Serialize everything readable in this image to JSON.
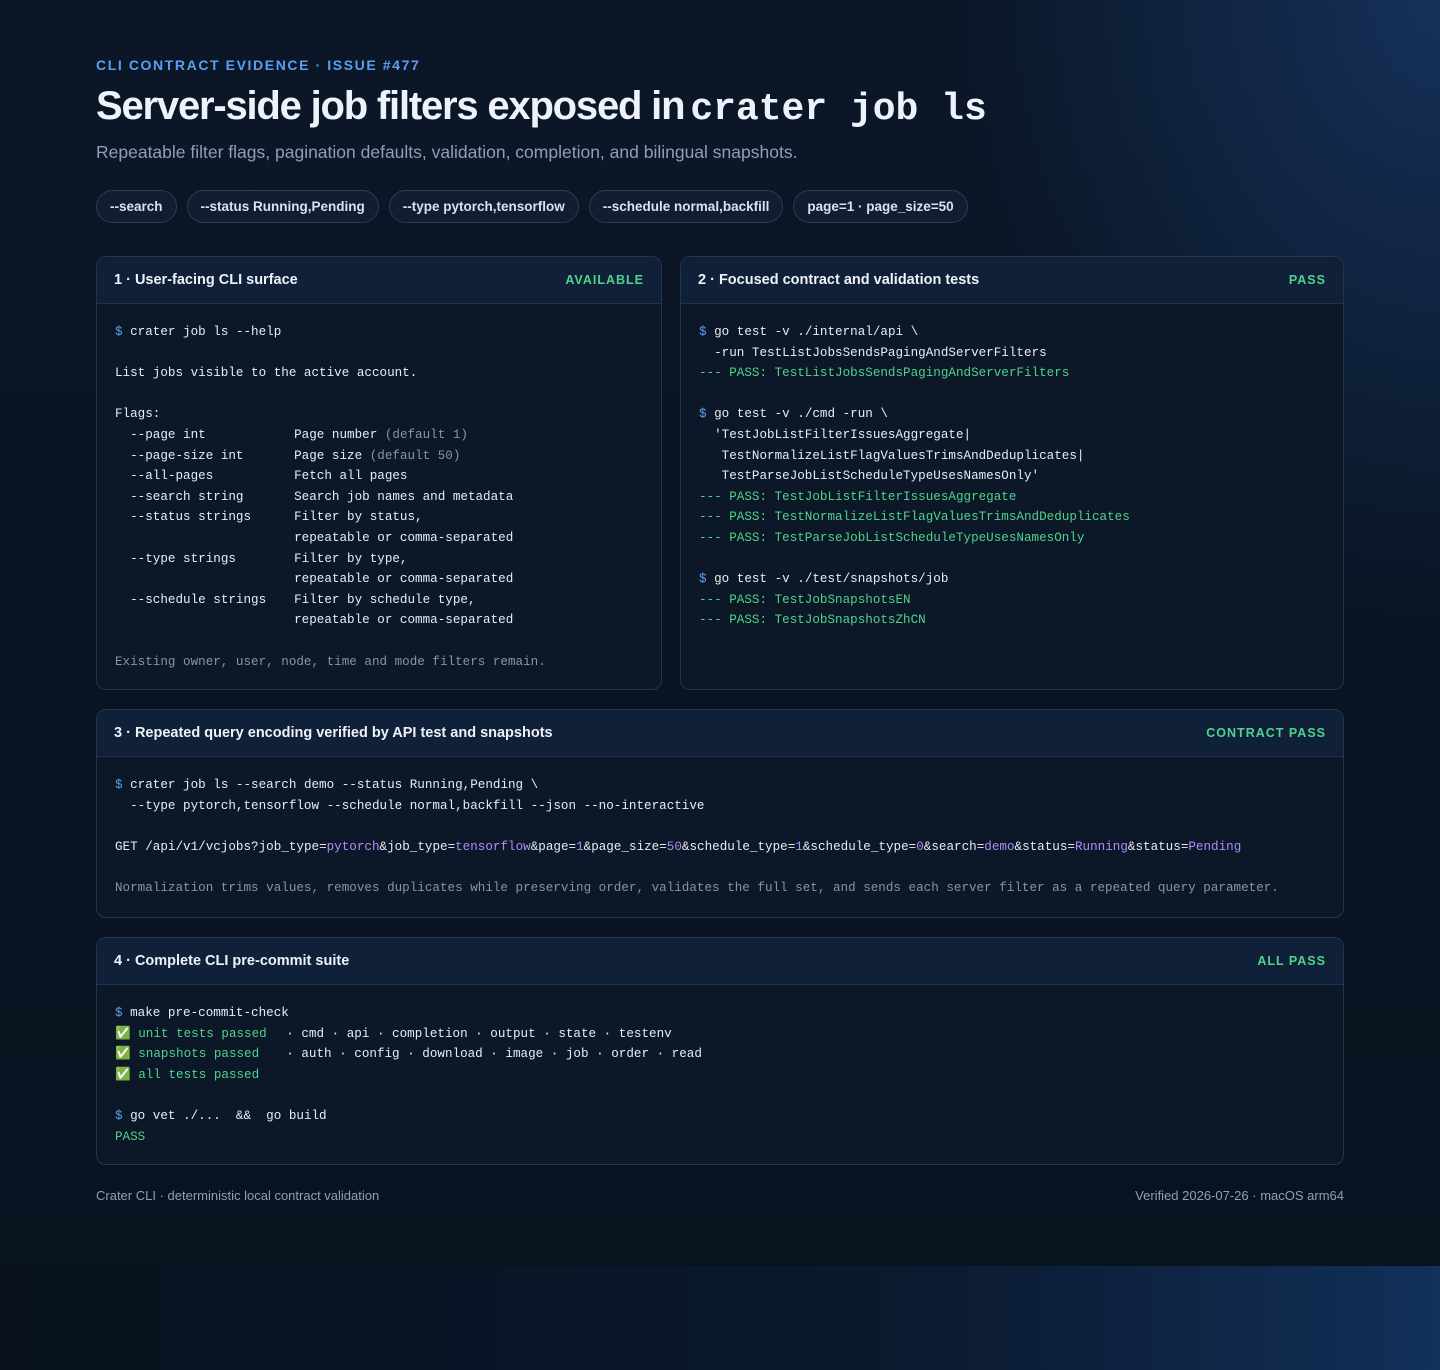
{
  "header": {
    "eyebrow": "CLI CONTRACT EVIDENCE · ISSUE #477",
    "title_text": "Server-side job filters exposed in",
    "title_code": "crater job ls",
    "subtitle": "Repeatable filter flags, pagination defaults, validation, completion, and bilingual snapshots."
  },
  "chips": [
    "--search",
    "--status Running,Pending",
    "--type pytorch,tensorflow",
    "--schedule normal,backfill",
    "page=1 · page_size=50"
  ],
  "card1": {
    "title": "1 · User-facing CLI surface",
    "status": "AVAILABLE",
    "prompt": "$",
    "command": "crater job ls --help",
    "description": "List jobs visible to the active account.",
    "flags_label": "Flags:",
    "flags": [
      {
        "flag": "--page int",
        "desc": "Page number",
        "note": "(default 1)"
      },
      {
        "flag": "--page-size int",
        "desc": "Page size",
        "note": "(default 50)"
      },
      {
        "flag": "--all-pages",
        "desc": "Fetch all pages",
        "note": ""
      },
      {
        "flag": "--search string",
        "desc": "Search job names and metadata",
        "note": ""
      },
      {
        "flag": "--status strings",
        "desc": "Filter by status,",
        "note": ""
      },
      {
        "flag": "",
        "desc": "repeatable or comma-separated",
        "note": ""
      },
      {
        "flag": "--type strings",
        "desc": "Filter by type,",
        "note": ""
      },
      {
        "flag": "",
        "desc": "repeatable or comma-separated",
        "note": ""
      },
      {
        "flag": "--schedule strings",
        "desc": "Filter by schedule type,",
        "note": ""
      },
      {
        "flag": "",
        "desc": "repeatable or comma-separated",
        "note": ""
      }
    ],
    "footnote": "Existing owner, user, node, time and mode filters remain."
  },
  "card2": {
    "title": "2 · Focused contract and validation tests",
    "status": "PASS",
    "block1": {
      "cmd": "go test -v ./internal/api \\",
      "cont": [
        "  -run TestListJobsSendsPagingAndServerFilters"
      ],
      "passes": [
        "--- PASS: TestListJobsSendsPagingAndServerFilters"
      ]
    },
    "block2": {
      "cmd": "go test -v ./cmd -run \\",
      "cont": [
        "  'TestJobListFilterIssuesAggregate|",
        "   TestNormalizeListFlagValuesTrimsAndDeduplicates|",
        "   TestParseJobListScheduleTypeUsesNamesOnly'"
      ],
      "passes": [
        "--- PASS: TestJobListFilterIssuesAggregate",
        "--- PASS: TestNormalizeListFlagValuesTrimsAndDeduplicates",
        "--- PASS: TestParseJobListScheduleTypeUsesNamesOnly"
      ]
    },
    "block3": {
      "cmd": "go test -v ./test/snapshots/job",
      "cont": [],
      "passes": [
        "--- PASS: TestJobSnapshotsEN",
        "--- PASS: TestJobSnapshotsZhCN"
      ]
    }
  },
  "card3": {
    "title": "3 · Repeated query encoding verified by API test and snapshots",
    "status": "CONTRACT PASS",
    "cmd_line1": "crater job ls --search demo --status Running,Pending \\",
    "cmd_line2": "  --type pytorch,tensorflow --schedule normal,backfill --json --no-interactive",
    "get_prefix": "GET /api/v1/vcjobs?",
    "query": [
      {
        "key": "job_type",
        "value": "pytorch"
      },
      {
        "key": "job_type",
        "value": "tensorflow"
      },
      {
        "key": "page",
        "value": "1"
      },
      {
        "key": "page_size",
        "value": "50"
      },
      {
        "key": "schedule_type",
        "value": "1"
      },
      {
        "key": "schedule_type",
        "value": "0"
      },
      {
        "key": "search",
        "value": "demo"
      },
      {
        "key": "status",
        "value": "Running"
      },
      {
        "key": "status",
        "value": "Pending"
      }
    ],
    "note": "Normalization trims values, removes duplicates while preserving order, validates the full set, and sends each server filter as a repeated query parameter."
  },
  "card4": {
    "title": "4 · Complete CLI pre-commit suite",
    "status": "ALL PASS",
    "cmd": "make pre-commit-check",
    "checks": [
      {
        "icon": "✅",
        "label": "unit tests passed",
        "detail": "· cmd · api · completion · output · state · testenv"
      },
      {
        "icon": "✅",
        "label": "snapshots passed",
        "detail": "· auth · config · download · image · job · order · read"
      },
      {
        "icon": "✅",
        "label": "all tests passed",
        "detail": ""
      }
    ],
    "cmd2": "go vet ./...  &&  go build",
    "result": "PASS"
  },
  "footer": {
    "left": "Crater CLI · deterministic local contract validation",
    "right": "Verified 2026-07-26 · macOS arm64"
  },
  "colors": {
    "accent": "#5aa0f2",
    "pass": "#4fd38a",
    "query_value": "#b28cf5",
    "background": "#0a1422"
  }
}
